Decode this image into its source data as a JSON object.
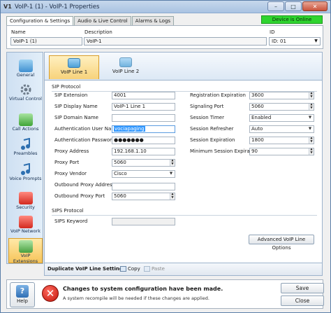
{
  "window": {
    "app_icon": "V1",
    "title": "VoIP-1 (1) - VoIP-1 Properties",
    "minimize": "–",
    "maximize": "□",
    "close": "✕"
  },
  "top_tabs": [
    {
      "label": "Configuration & Settings"
    },
    {
      "label": "Audio & Live Control"
    },
    {
      "label": "Alarms & Logs"
    }
  ],
  "status": {
    "text": "Device is Online",
    "color": "#2fd42f"
  },
  "header": {
    "name_label": "Name",
    "name_value": "VoIP-1 (1)",
    "description_label": "Description",
    "description_value": "VoIP-1",
    "id_label": "ID",
    "id_value": "ID: 01"
  },
  "nav": [
    {
      "label": "General",
      "icon": "general-icon"
    },
    {
      "label": "Virtual Control",
      "icon": "virtual-control-icon"
    },
    {
      "label": "Call Actions",
      "icon": "call-actions-icon"
    },
    {
      "label": "Preambles",
      "icon": "preambles-icon"
    },
    {
      "label": "Voice Prompts",
      "icon": "voice-prompts-icon"
    },
    {
      "label": "Security",
      "icon": "security-icon"
    },
    {
      "label": "VoIP Network",
      "icon": "voip-network-icon"
    },
    {
      "label": "VoIP Extensions",
      "icon": "voip-extensions-icon"
    }
  ],
  "line_tabs": [
    {
      "label": "VoIP Line 1"
    },
    {
      "label": "VoIP Line 2"
    }
  ],
  "sip": {
    "section": "SIP Protocol",
    "extension": {
      "label": "SIP Extension",
      "value": "4001"
    },
    "display_name": {
      "label": "SIP Display Name",
      "value": "VoIP-1 Line 1"
    },
    "domain_name": {
      "label": "SIP Domain Name",
      "value": ""
    },
    "auth_user": {
      "label": "Authentication User Name",
      "value": "vociapaging"
    },
    "auth_password": {
      "label": "Authentication Password",
      "value": "●●●●●●●"
    },
    "proxy_address": {
      "label": "Proxy Address",
      "value": "192.168.1.10"
    },
    "proxy_port": {
      "label": "Proxy Port",
      "value": "5060"
    },
    "proxy_vendor": {
      "label": "Proxy Vendor",
      "value": "Cisco"
    },
    "outbound_address": {
      "label": "Outbound Proxy Address",
      "value": ""
    },
    "outbound_port": {
      "label": "Outbound Proxy Port",
      "value": "5060"
    },
    "registration_expiration": {
      "label": "Registration Expiration",
      "value": "3600"
    },
    "signaling_port": {
      "label": "Signaling Port",
      "value": "5060"
    },
    "session_timer": {
      "label": "Session Timer",
      "value": "Enabled"
    },
    "session_refresher": {
      "label": "Session Refresher",
      "value": "Auto"
    },
    "session_expiration": {
      "label": "Session Expiration",
      "value": "1800"
    },
    "min_session_expiration": {
      "label": "Minimum Session Expiration",
      "value": "90"
    }
  },
  "sips": {
    "section": "SIPS Protocol",
    "keyword": {
      "label": "SIPS Keyword",
      "value": ""
    }
  },
  "advanced_button": "Advanced VoIP Line Options",
  "duplicate": {
    "label": "Duplicate VoIP Line Settings",
    "copy": "Copy",
    "paste": "Paste"
  },
  "footer": {
    "help": "Help",
    "help_glyph": "?",
    "error_glyph": "✕",
    "message": "Changes to system configuration have been made.",
    "submessage": "A system recompile will be needed if these changes are applied.",
    "save": "Save",
    "close": "Close"
  }
}
